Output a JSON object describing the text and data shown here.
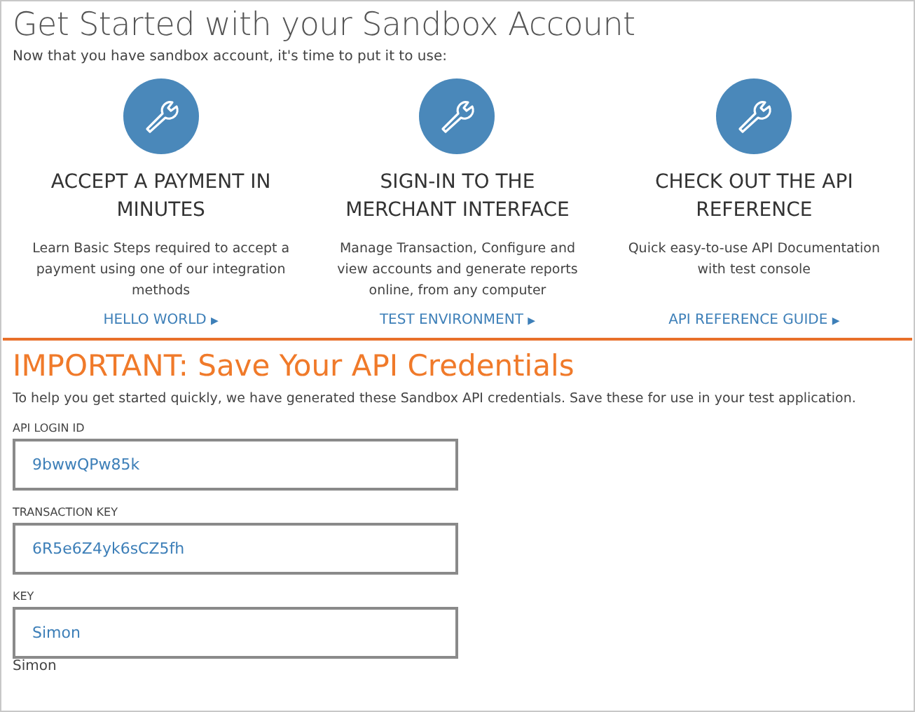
{
  "title": "Get Started with your Sandbox Account",
  "intro": "Now that you have sandbox account, it's time to put it to use:",
  "cards": [
    {
      "heading": "ACCEPT A PAYMENT IN MINUTES",
      "description": "Learn Basic Steps required to accept a payment using one of our integration methods",
      "link": "HELLO WORLD",
      "arrow": "▶"
    },
    {
      "heading": "SIGN-IN TO THE MERCHANT INTERFACE",
      "description": "Manage Transaction, Configure and view accounts and generate reports online, from any computer",
      "link": "TEST ENVIRONMENT",
      "arrow": "▶"
    },
    {
      "heading": "CHECK OUT THE API REFERENCE",
      "description": "Quick easy-to-use API Documentation with test console",
      "link": "API REFERENCE GUIDE",
      "arrow": "▶"
    }
  ],
  "important": {
    "heading": "IMPORTANT: Save Your API Credentials",
    "text": "To help you get started quickly, we have generated these Sandbox API credentials. Save these for use in your test application."
  },
  "fields": [
    {
      "label": "API LOGIN ID",
      "value": "9bwwQPw85k"
    },
    {
      "label": "TRANSACTION KEY",
      "value": "6R5e6Z4yk6sCZ5fh"
    },
    {
      "label": "KEY",
      "value": "Simon"
    }
  ],
  "footer_text": "Simon"
}
